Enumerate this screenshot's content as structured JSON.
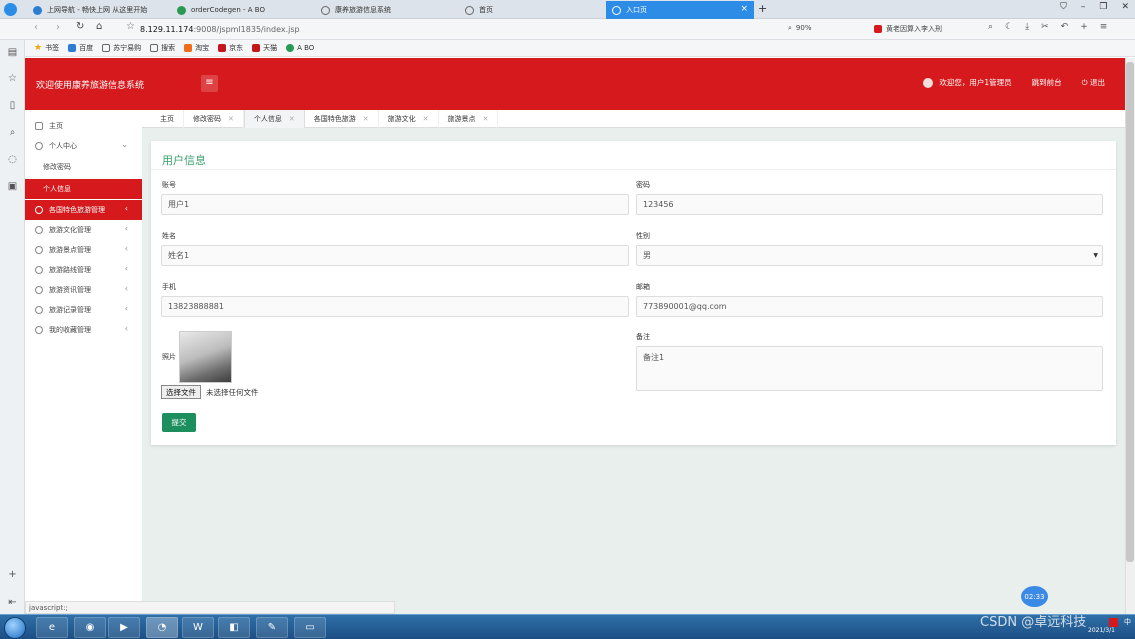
{
  "browser": {
    "tabs": [
      {
        "label": "上网导航 - 畅快上网 从这里开始",
        "color": "#2d7dd2"
      },
      {
        "label": "orderCodegen - A BO",
        "color": "#2a9a52"
      },
      {
        "label": "康养旅游信息系统",
        "color": "#666666"
      },
      {
        "label": "首页",
        "color": "#666666"
      },
      {
        "label": "入口页",
        "color": "#ffffff"
      }
    ],
    "close_glyph": "×",
    "new_tab_glyph": "+",
    "url_host": "8.129.11.174",
    "url_path": ":9008/jspml1835/index.jsp",
    "zoom": "90%",
    "search_hint": "黄老因算入李入刑",
    "bookmarks": [
      "书签",
      "百度",
      "苏宁易购",
      "搜索",
      "淘宝",
      "京东",
      "天猫",
      "A BO"
    ]
  },
  "header": {
    "title": "欢迎使用康养旅游信息系统",
    "menu_glyph": "≡",
    "welcome": "欢迎您，用户1管理员",
    "goto_front": "跳到前台",
    "logout": "退出"
  },
  "sidebar": {
    "items": [
      {
        "label": "主页",
        "arrow": ""
      },
      {
        "label": "个人中心",
        "arrow": "⌄"
      },
      {
        "label": "修改密码",
        "arrow": ""
      },
      {
        "label": "个人信息",
        "arrow": ""
      },
      {
        "label": "各国特色旅游管理",
        "arrow": "‹"
      },
      {
        "label": "旅游文化管理",
        "arrow": "‹"
      },
      {
        "label": "旅游景点管理",
        "arrow": "‹"
      },
      {
        "label": "旅游路线管理",
        "arrow": "‹"
      },
      {
        "label": "旅游资讯管理",
        "arrow": "‹"
      },
      {
        "label": "旅游记录管理",
        "arrow": "‹"
      },
      {
        "label": "我的收藏管理",
        "arrow": "‹"
      }
    ]
  },
  "content_tabs": [
    {
      "label": "主页"
    },
    {
      "label": "修改密码"
    },
    {
      "label": "个人信息"
    },
    {
      "label": "各国特色旅游"
    },
    {
      "label": "旅游文化"
    },
    {
      "label": "旅游景点"
    }
  ],
  "form": {
    "title": "用户信息",
    "account_label": "账号",
    "account_value": "用户1",
    "password_label": "密码",
    "password_value": "123456",
    "name_label": "姓名",
    "name_value": "姓名1",
    "gender_label": "性别",
    "gender_value": "男",
    "gender_arrow": "▼",
    "phone_label": "手机",
    "phone_value": "13823888881",
    "email_label": "邮箱",
    "email_value": "773890001@qq.com",
    "photo_label": "照片",
    "file_button": "选择文件",
    "file_status": "未选择任何文件",
    "remark_label": "备注",
    "remark_value": "备注1",
    "submit": "提交"
  },
  "status_bar": "javascript:;",
  "clock_badge": "02:33",
  "taskbar": {
    "ime": "中",
    "date": "2021/3/1",
    "watermark": "CSDN @卓远科技"
  }
}
